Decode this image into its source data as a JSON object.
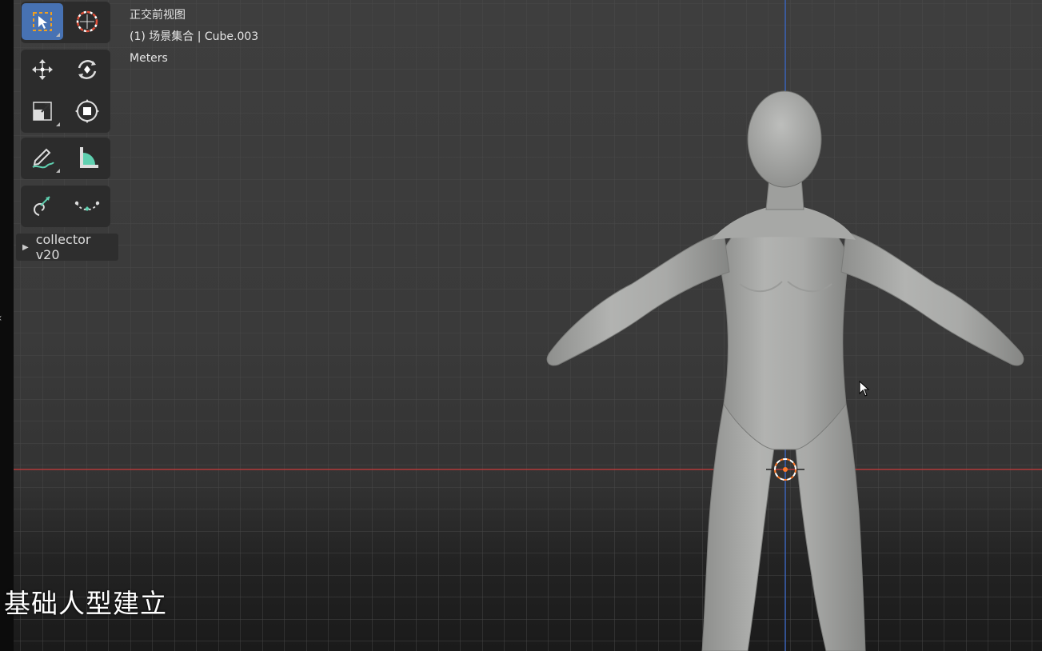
{
  "viewport": {
    "view_name": "正交前视图",
    "scene_info": "(1) 场景集合 | Cube.003",
    "units": "Meters",
    "x_axis_color": "#b33a3a",
    "z_axis_color": "#3a63b8",
    "background_color": "#3a3a3a"
  },
  "toolbar": {
    "tools": [
      {
        "name": "select-box",
        "icon": "select-box-icon",
        "active": true
      },
      {
        "name": "cursor",
        "icon": "cursor-3d-icon",
        "active": false
      },
      {
        "name": "move",
        "icon": "move-icon",
        "active": false
      },
      {
        "name": "rotate",
        "icon": "rotate-icon",
        "active": false
      },
      {
        "name": "scale",
        "icon": "scale-icon",
        "active": false
      },
      {
        "name": "transform",
        "icon": "transform-icon",
        "active": false
      },
      {
        "name": "annotate",
        "icon": "annotate-icon",
        "active": false
      },
      {
        "name": "measure",
        "icon": "measure-icon",
        "active": false
      },
      {
        "name": "add-cube",
        "icon": "add-object-icon",
        "active": false
      },
      {
        "name": "curve",
        "icon": "curve-icon",
        "active": false
      }
    ],
    "active_color": "#4772b3"
  },
  "collector_panel": {
    "label": "collector v20"
  },
  "subtitle": {
    "text": "基础人型建立"
  },
  "model": {
    "name": "Cube.003",
    "color": "#a9aaa8"
  }
}
